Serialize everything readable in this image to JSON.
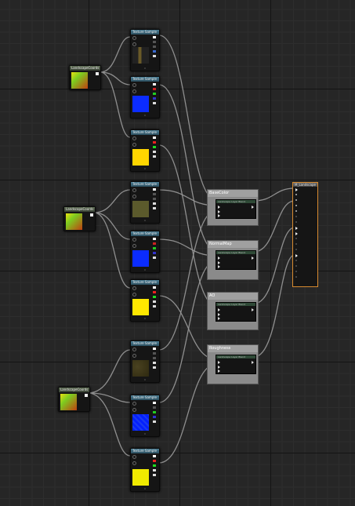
{
  "canvas": {
    "accent_result_border": "#d78a2f",
    "grid_major": "#141414",
    "grid_minor": "#2d2d2d",
    "background": "#262626"
  },
  "landscape_coords": [
    {
      "title": "LandscapeCoords"
    },
    {
      "title": "LandscapeCoords"
    },
    {
      "title": "LandscapeCoords"
    }
  ],
  "texture_samples": [
    {
      "title": "Texture Sample",
      "preview": "#524a20",
      "footer": "0"
    },
    {
      "title": "Texture Sample",
      "preview": "#0b2cff",
      "footer": "0"
    },
    {
      "title": "Texture Sample",
      "preview": "#ffd600",
      "footer": "0"
    },
    {
      "title": "Texture Sample",
      "preview": "#5b5a2c",
      "footer": "0"
    },
    {
      "title": "Texture Sample",
      "preview": "#0b2cff",
      "footer": "0"
    },
    {
      "title": "Texture Sample",
      "preview": "#ffe800",
      "footer": "0"
    },
    {
      "title": "Texture Sample",
      "preview": "#3d3718",
      "footer": "0"
    },
    {
      "title": "Texture Sample",
      "preview": "#0420ff",
      "footer": "0"
    },
    {
      "title": "Texture Sample",
      "preview": "#f0ea00",
      "footer": "0"
    }
  ],
  "blend_nodes": [
    {
      "title": "BaseColor",
      "sub": "Landscape Layer Blend"
    },
    {
      "title": "NormalMap",
      "sub": "Landscape Layer Blend"
    },
    {
      "title": "AO",
      "sub": "Landscape Layer Blend"
    },
    {
      "title": "Roughness",
      "sub": "Landscape Layer Blend"
    }
  ],
  "result_node": {
    "title": "M_Landscape"
  }
}
